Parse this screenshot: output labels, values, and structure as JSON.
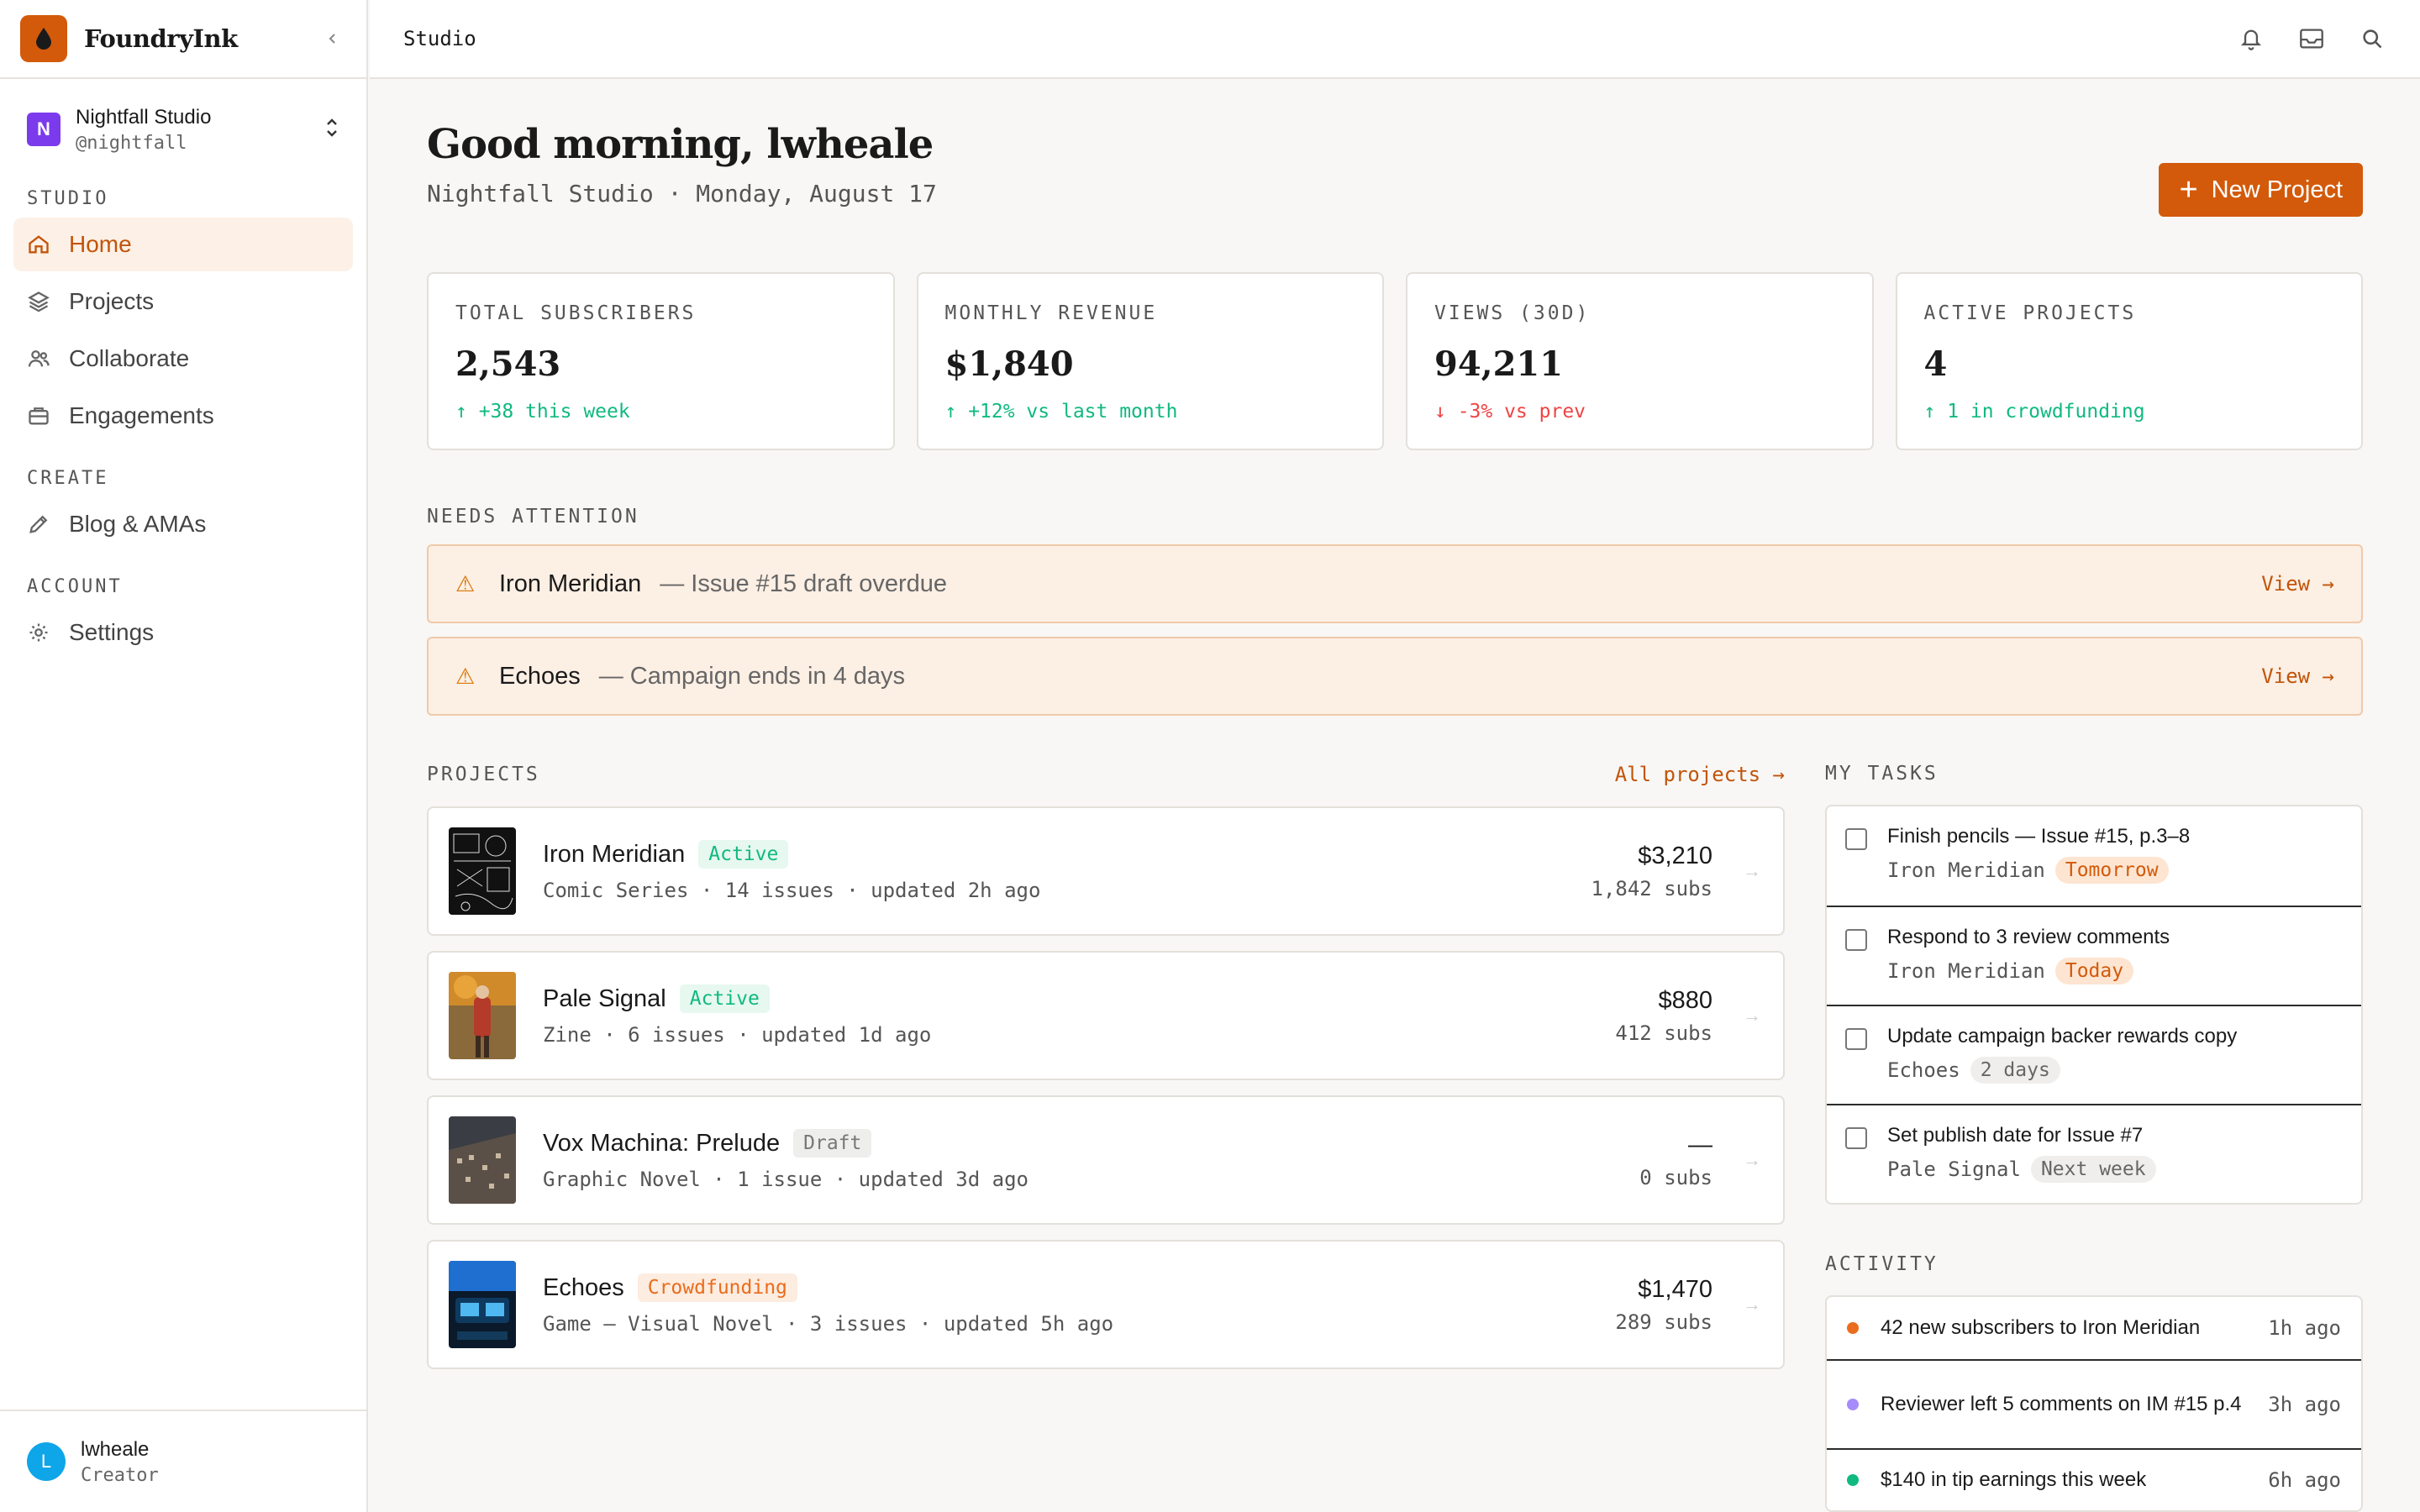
{
  "brand": {
    "name": "FoundryInk",
    "color": "#d35a0a"
  },
  "workspace": {
    "initial": "N",
    "name": "Nightfall Studio",
    "handle": "@nightfall"
  },
  "nav": {
    "studio_label": "STUDIO",
    "create_label": "CREATE",
    "account_label": "ACCOUNT",
    "home": "Home",
    "projects": "Projects",
    "collaborate": "Collaborate",
    "engagements": "Engagements",
    "blog": "Blog & AMAs",
    "settings": "Settings"
  },
  "user": {
    "initial": "L",
    "name": "lwheale",
    "role": "Creator"
  },
  "topbar": {
    "title": "Studio"
  },
  "header": {
    "greeting": "Good morning, lwheale",
    "subtitle": "Nightfall Studio · Monday, August 17",
    "new_project": "New Project"
  },
  "stats": [
    {
      "label": "TOTAL SUBSCRIBERS",
      "value": "2,543",
      "delta": "↑ +38 this week",
      "trend": "up"
    },
    {
      "label": "MONTHLY REVENUE",
      "value": "$1,840",
      "delta": "↑ +12% vs last month",
      "trend": "up"
    },
    {
      "label": "VIEWS (30D)",
      "value": "94,211",
      "delta": "↓ -3% vs prev",
      "trend": "down"
    },
    {
      "label": "ACTIVE PROJECTS",
      "value": "4",
      "delta": "↑ 1 in crowdfunding",
      "trend": "up"
    }
  ],
  "attention": {
    "label": "NEEDS ATTENTION",
    "items": [
      {
        "title": "Iron Meridian",
        "desc": "— Issue #15 draft overdue",
        "link": "View →"
      },
      {
        "title": "Echoes",
        "desc": "— Campaign ends in 4 days",
        "link": "View →"
      }
    ]
  },
  "projects": {
    "label": "PROJECTS",
    "link": "All projects →",
    "items": [
      {
        "name": "Iron Meridian",
        "badge": "Active",
        "meta": "Comic Series · 14 issues · updated 2h ago",
        "revenue": "$3,210",
        "subs": "1,842 subs"
      },
      {
        "name": "Pale Signal",
        "badge": "Active",
        "meta": "Zine · 6 issues · updated 1d ago",
        "revenue": "$880",
        "subs": "412 subs"
      },
      {
        "name": "Vox Machina: Prelude",
        "badge": "Draft",
        "meta": "Graphic Novel · 1 issue · updated 3d ago",
        "revenue": "—",
        "subs": "0 subs"
      },
      {
        "name": "Echoes",
        "badge": "Crowdfunding",
        "meta": "Game — Visual Novel · 3 issues · updated 5h ago",
        "revenue": "$1,470",
        "subs": "289 subs"
      }
    ]
  },
  "tasks": {
    "label": "MY TASKS",
    "items": [
      {
        "title": "Finish pencils — Issue #15, p.3–8",
        "project": "Iron Meridian",
        "due": "Tomorrow"
      },
      {
        "title": "Respond to 3 review comments",
        "project": "Iron Meridian",
        "due": "Today"
      },
      {
        "title": "Update campaign backer rewards copy",
        "project": "Echoes",
        "due": "2 days"
      },
      {
        "title": "Set publish date for Issue #7",
        "project": "Pale Signal",
        "due": "Next week"
      }
    ]
  },
  "activity": {
    "label": "ACTIVITY",
    "items": [
      {
        "text": "42 new subscribers to Iron Meridian",
        "time": "1h ago",
        "color": "#ea6c1c"
      },
      {
        "text": "Reviewer left 5 comments on IM #15 p.4",
        "time": "3h ago",
        "color": "#a78bfa"
      },
      {
        "text": "$140 in tip earnings this week",
        "time": "6h ago",
        "color": "#10b981"
      }
    ]
  },
  "icons": {
    "bell": "bell-icon",
    "inbox": "inbox-icon",
    "search": "search-icon",
    "home": "home-icon",
    "projects": "layers-icon",
    "collaborate": "users-icon",
    "engagements": "briefcase-icon",
    "blog": "pencil-icon",
    "settings": "gear-icon",
    "alert": "warning-icon"
  }
}
